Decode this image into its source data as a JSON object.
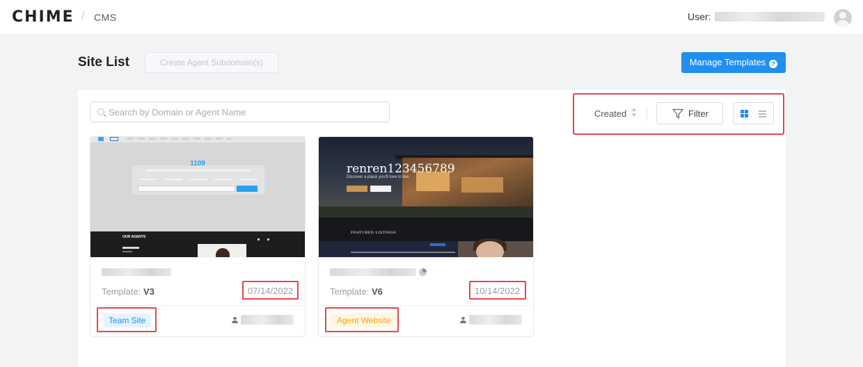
{
  "header": {
    "logo": "CHIME",
    "separator": "/",
    "section": "CMS",
    "user_label": "User:"
  },
  "page": {
    "title": "Site List",
    "create_button": "Create Agent Subdomain(s)",
    "manage_button": "Manage Templates",
    "help_glyph": "?"
  },
  "toolbar": {
    "search_placeholder": "Search by Domain or Agent Name",
    "sort_label": "Created",
    "filter_label": "Filter",
    "view_mode": "grid"
  },
  "cards": [
    {
      "template_label": "Template:",
      "template_version": "V3",
      "date": "07/14/2022",
      "tag": "Team Site",
      "preview": {
        "hero_title": "1109",
        "section_label": "OUR AGENTS"
      }
    },
    {
      "template_label": "Template:",
      "template_version": "V6",
      "date": "10/14/2022",
      "tag": "Agent Website",
      "preview": {
        "hero_title": "renren123456789",
        "hero_subtitle": "Discover a place you'll love to live",
        "section_label": "FEATURED LISTINGS"
      }
    }
  ],
  "colors": {
    "accent": "#1f8ff0",
    "highlight": "#e8434d",
    "team_tag": "#1f8ff0",
    "agent_tag": "#f5a623"
  }
}
